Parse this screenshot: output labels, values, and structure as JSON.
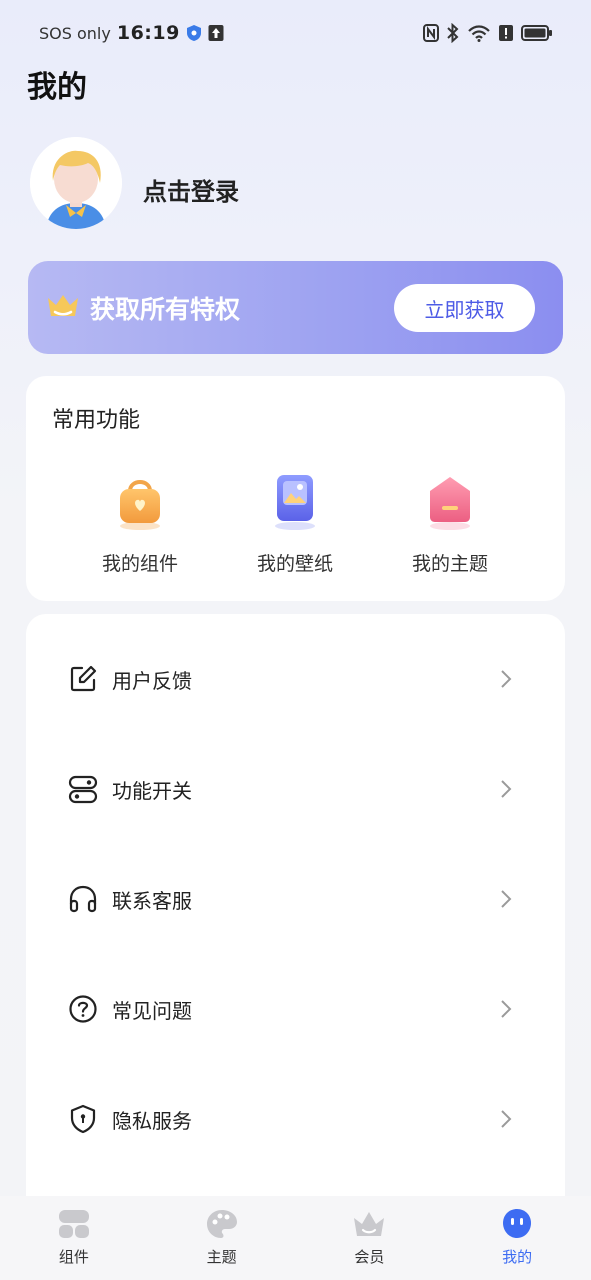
{
  "status_bar": {
    "carrier": "SOS only",
    "time": "16:19"
  },
  "page": {
    "title": "我的"
  },
  "profile": {
    "login_label": "点击登录"
  },
  "vip_banner": {
    "text": "获取所有特权",
    "button_label": "立即获取"
  },
  "common_functions": {
    "title": "常用功能",
    "items": [
      {
        "label": "我的组件",
        "icon": "bag-icon"
      },
      {
        "label": "我的壁纸",
        "icon": "wallpaper-icon"
      },
      {
        "label": "我的主题",
        "icon": "home-theme-icon"
      }
    ]
  },
  "menu": {
    "items": [
      {
        "label": "用户反馈",
        "icon": "edit-icon"
      },
      {
        "label": "功能开关",
        "icon": "toggle-icon"
      },
      {
        "label": "联系客服",
        "icon": "headset-icon"
      },
      {
        "label": "常见问题",
        "icon": "question-icon"
      },
      {
        "label": "隐私服务",
        "icon": "shield-icon"
      }
    ]
  },
  "bottom_nav": {
    "items": [
      {
        "label": "组件",
        "icon": "widgets-icon"
      },
      {
        "label": "主题",
        "icon": "palette-icon"
      },
      {
        "label": "会员",
        "icon": "crown-icon"
      },
      {
        "label": "我的",
        "icon": "profile-face-icon"
      }
    ],
    "active_index": 3
  },
  "colors": {
    "accent": "#3d6cf2",
    "vip_button_text": "#4d5be6",
    "banner_start": "#b6b9f3",
    "banner_end": "#8b8ef0"
  }
}
